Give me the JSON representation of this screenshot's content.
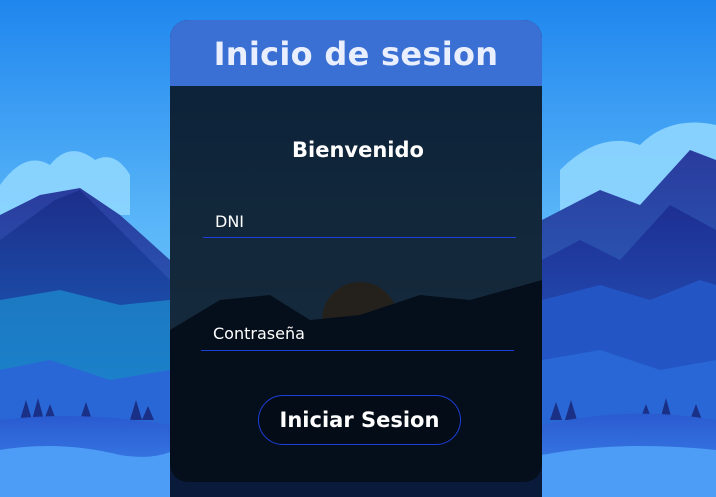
{
  "login": {
    "title": "Inicio de sesion",
    "welcome": "Bienvenido",
    "dni_placeholder": "DNI",
    "password_placeholder": "Contraseña",
    "submit_label": "Iniciar Sesion"
  },
  "colors": {
    "header": "#3a6fd4",
    "field_underline": "#1c3fd8",
    "button_border": "#1c3fd8",
    "card_background": "#050c16"
  },
  "background": {
    "image": "mountain-landscape"
  }
}
